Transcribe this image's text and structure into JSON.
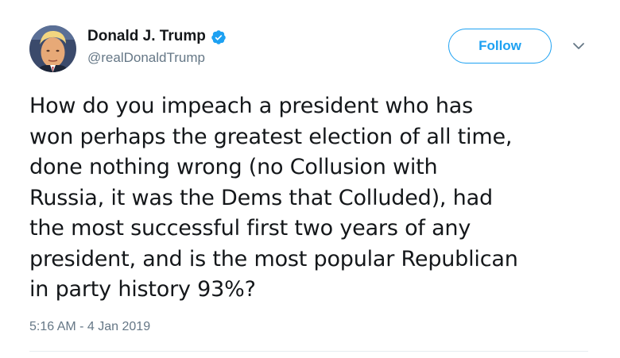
{
  "author": {
    "display_name": "Donald J. Trump",
    "handle": "@realDonaldTrump",
    "verified": true
  },
  "actions": {
    "follow_label": "Follow",
    "menu_icon": "chevron-down-icon"
  },
  "tweet": {
    "lines": [
      "How do you impeach a president who has",
      "won perhaps the greatest election of all time,",
      "done nothing wrong (no Collusion with",
      "Russia, it was the Dems that Colluded), had",
      "the most successful first two years of any",
      "president, and is the most popular Republican",
      "in party history 93%?"
    ],
    "timestamp": "5:16 AM - 4 Jan 2019"
  },
  "colors": {
    "accent": "#1da1f2",
    "secondary_text": "#657786",
    "primary_text": "#14171a"
  }
}
